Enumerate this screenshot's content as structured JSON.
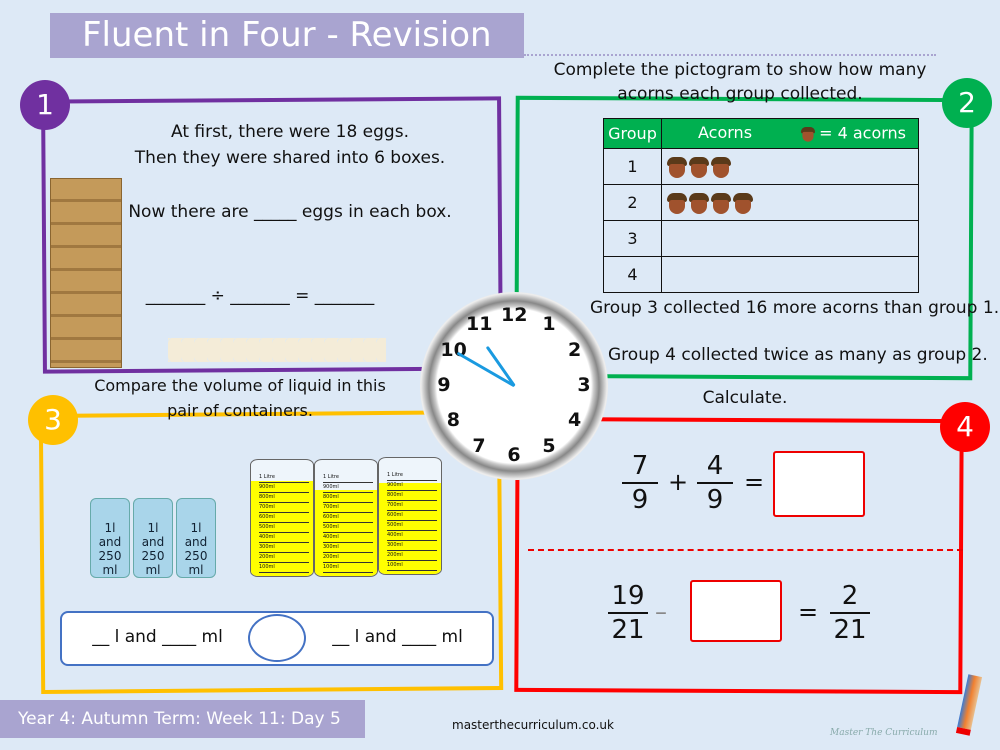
{
  "title": "Fluent in Four - Revision",
  "colors": {
    "q1": "#7030a0",
    "q2": "#00b050",
    "q3": "#ffc000",
    "q4": "#ff0000",
    "banner": "#a9a4d0",
    "background": "#dde9f6"
  },
  "q1": {
    "number": "1",
    "line1": "At first, there were 18 eggs.",
    "line2": "Then they were shared into 6 boxes.",
    "line3": "Now there are _____ eggs in each box.",
    "equation": "_______ ÷ _______ = _______"
  },
  "q2": {
    "number": "2",
    "instruction1": "Complete the pictogram to show how many",
    "instruction2": "acorns each group collected.",
    "headers": {
      "group": "Group",
      "acorns": "Acorns",
      "key": "= 4 acorns"
    },
    "rows": [
      {
        "group": "1",
        "acorns": 3
      },
      {
        "group": "2",
        "acorns": 4
      },
      {
        "group": "3",
        "acorns": 0
      },
      {
        "group": "4",
        "acorns": 0
      }
    ],
    "fact1": "Group 3 collected 16 more acorns than group 1.",
    "fact2": "Group 4 collected twice as many as group 2."
  },
  "q3": {
    "number": "3",
    "line1": "Compare the volume of liquid in this",
    "line2": "pair of containers.",
    "jars": [
      [
        "1l",
        "and",
        "250 ml"
      ],
      [
        "1l",
        "and",
        "250 ml"
      ],
      [
        "1l",
        "and",
        "250 ml"
      ]
    ],
    "beaker_scale": [
      "1 Litre",
      "900ml",
      "800ml",
      "700ml",
      "600ml",
      "500ml",
      "400ml",
      "300ml",
      "200ml",
      "100ml"
    ],
    "beaker_fill_ml": [
      950,
      850,
      900
    ],
    "answer_left": "__ l and ____ ml",
    "answer_right": "__ l and ____ ml"
  },
  "q4": {
    "number": "4",
    "heading": "Calculate.",
    "sum1": {
      "a_num": "7",
      "a_den": "9",
      "op": "+",
      "b_num": "4",
      "b_den": "9",
      "eq": "="
    },
    "sum2": {
      "a_num": "19",
      "a_den": "21",
      "op": "–",
      "eq": "=",
      "c_num": "2",
      "c_den": "21"
    }
  },
  "clock": {
    "numbers": [
      "12",
      "1",
      "2",
      "3",
      "4",
      "5",
      "6",
      "7",
      "8",
      "9",
      "10",
      "11"
    ],
    "time": "10:50"
  },
  "footer": {
    "label": "Year 4: Autumn Term: Week 11: Day 5",
    "url": "masterthecurriculum.co.uk",
    "logo": "Master The Curriculum"
  }
}
